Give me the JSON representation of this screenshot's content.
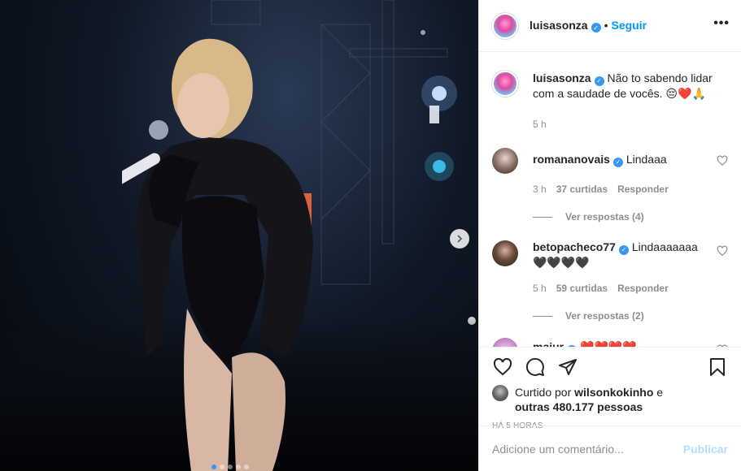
{
  "post": {
    "author": "luisasonza",
    "follow_label": "Seguir",
    "more_label": "•••",
    "separator": "•",
    "caption_text": "Não to sabendo lidar com a saudade de vocês. 😔❤️🙏",
    "caption_time": "5 h"
  },
  "comments": [
    {
      "user": "romananovais",
      "verified": true,
      "text": "Lindaaa",
      "time": "3 h",
      "likes": "37 curtidas",
      "reply_label": "Responder",
      "view_replies": "Ver respostas (4)"
    },
    {
      "user": "betopacheco77",
      "verified": true,
      "text": "Lindaaaaaaa",
      "text2": "🖤🖤🖤🖤",
      "time": "5 h",
      "likes": "59 curtidas",
      "reply_label": "Responder",
      "view_replies": "Ver respostas (2)"
    },
    {
      "user": "majur",
      "verified": true,
      "text": "❤️❤️❤️❤️"
    }
  ],
  "likes": {
    "prefix": "Curtido por ",
    "user": "wilsonkokinho",
    "middle": " e",
    "others": "outras 480.177 pessoas"
  },
  "posted_ago": "HÁ 5 HORAS",
  "add_comment": {
    "placeholder": "Adicione um comentário...",
    "publish_label": "Publicar"
  },
  "colors": {
    "accent": "#0095f6",
    "verified": "#3897f0",
    "publish_disabled": "#b2dffc",
    "heart_red": "#ed4956"
  },
  "carousel": {
    "slides": 5,
    "current": 1
  }
}
